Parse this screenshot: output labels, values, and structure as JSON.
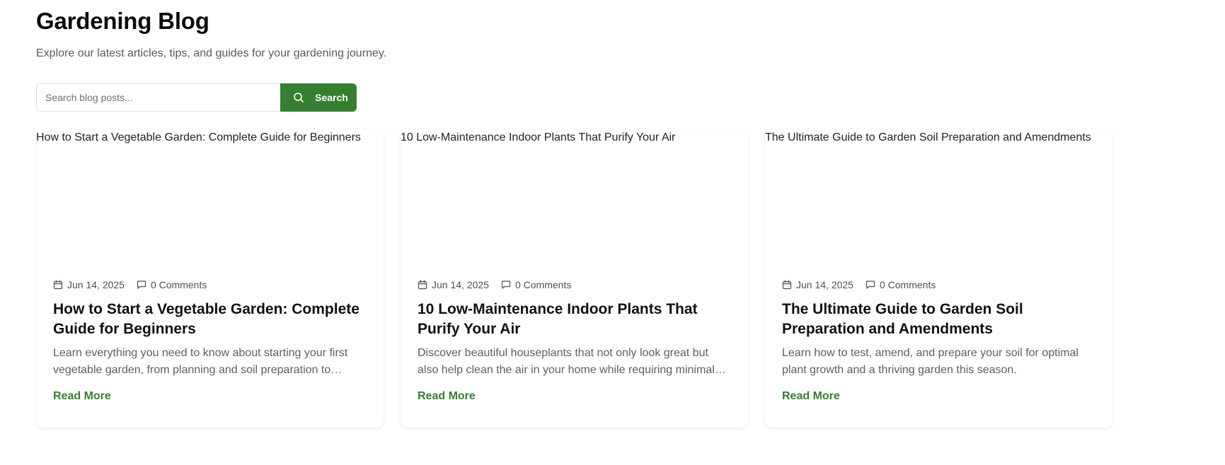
{
  "page": {
    "title": "Gardening Blog",
    "subtitle": "Explore our latest articles, tips, and guides for your gardening journey."
  },
  "search": {
    "placeholder": "Search blog posts...",
    "value": "",
    "button_label": "Search",
    "button_icon": "search-icon"
  },
  "colors": {
    "accent": "#367e31",
    "text": "#111111",
    "muted": "#5a5f66"
  },
  "posts": [
    {
      "image_alt": "How to Start a Vegetable Garden: Complete Guide for Beginners",
      "date": "Jun 14, 2025",
      "comments": "0 Comments",
      "title": "How to Start a Vegetable Garden: Complete Guide for Beginners",
      "excerpt": "Learn everything you need to know about starting your first vegetable garden, from planning and soil preparation to selecting the right plants.",
      "read_more": "Read More"
    },
    {
      "image_alt": "10 Low-Maintenance Indoor Plants That Purify Your Air",
      "date": "Jun 14, 2025",
      "comments": "0 Comments",
      "title": "10 Low-Maintenance Indoor Plants That Purify Your Air",
      "excerpt": "Discover beautiful houseplants that not only look great but also help clean the air in your home while requiring minimal care.",
      "read_more": "Read More"
    },
    {
      "image_alt": "The Ultimate Guide to Garden Soil Preparation and Amendments",
      "date": "Jun 14, 2025",
      "comments": "0 Comments",
      "title": "The Ultimate Guide to Garden Soil Preparation and Amendments",
      "excerpt": "Learn how to test, amend, and prepare your soil for optimal plant growth and a thriving garden this season.",
      "read_more": "Read More"
    }
  ]
}
